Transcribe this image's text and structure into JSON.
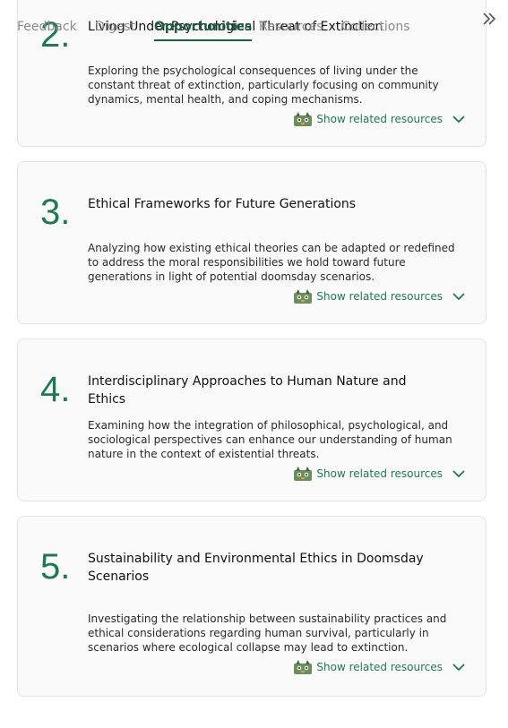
{
  "nav": {
    "tabs": [
      {
        "label": "Feedback"
      },
      {
        "label": "Digest"
      },
      {
        "label": "Opportunities"
      },
      {
        "label": "Resources"
      },
      {
        "label": "Collections"
      }
    ],
    "active_tab": "Opportunities",
    "collapse_icon": "double-chevron-right-icon"
  },
  "cards": [
    {
      "number": "2.",
      "title": "Living Under Psychological Threat of Extinction",
      "description": "Exploring the psychological consequences of living under the constant threat of extinction, particularly focusing on community dynamics, mental health, and coping mechanisms.",
      "related_label": "Show related resources"
    },
    {
      "number": "3.",
      "title": "Ethical Frameworks for Future Generations",
      "description": "Analyzing how existing ethical theories can be adapted or redefined to address the moral responsibilities we hold toward future generations in light of potential doomsday scenarios.",
      "related_label": "Show related resources"
    },
    {
      "number": "4.",
      "title": "Interdisciplinary Approaches to Human Nature and Ethics",
      "description": "Examining how the integration of philosophical, psychological, and sociological perspectives can enhance our understanding of human nature in the context of existential threats.",
      "related_label": "Show related resources"
    },
    {
      "number": "5.",
      "title": "Sustainability and Environmental Ethics in Doomsday Scenarios",
      "description": "Investigating the relationship between sustainability practices and ethical considerations regarding human survival, particularly in scenarios where ecological collapse may lead to extinction.",
      "related_label": "Show related resources"
    }
  ],
  "colors": {
    "accent": "#1e7a52",
    "active_tab": "#1e5c42",
    "card_border": "#e3e3e3",
    "card_bg": "#fafafa"
  }
}
